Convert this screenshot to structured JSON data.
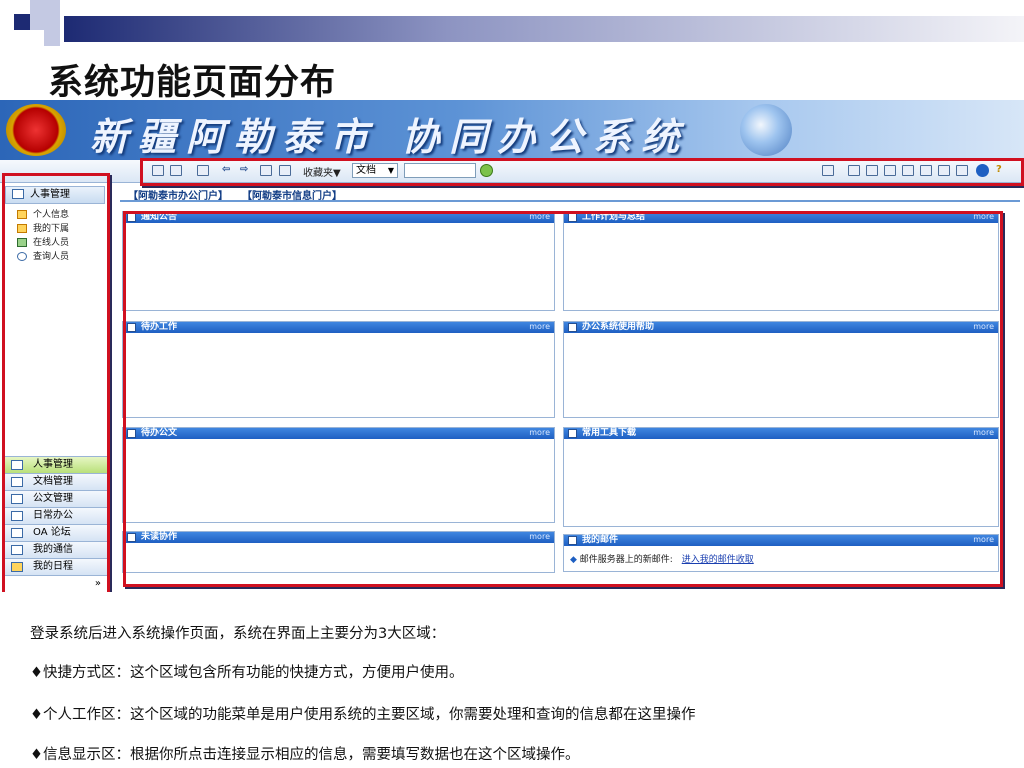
{
  "slide": {
    "title": "系统功能页面分布",
    "lines": [
      "登录系统后进入系统操作页面，系统在界面上主要分为3大区域：",
      "♦快捷方式区：这个区域包含所有功能的快捷方式，方便用户使用。",
      "♦个人工作区：这个区域的功能菜单是用户使用系统的主要区域，你需要处理和查询的信息都在这里操作",
      "♦信息显示区：根据你所点击连接显示相应的信息，需要填写数据也在这个区域操作。"
    ]
  },
  "app": {
    "banner_title": "新疆阿勒泰市 协同办公系统",
    "toolbar": {
      "favorites": "收藏夹▼",
      "doc_select": "文档",
      "search_value": ""
    },
    "left": {
      "header": "人事管理",
      "tree": [
        "个人信息",
        "我的下属",
        "在线人员",
        "查询人员"
      ],
      "menu": [
        "人事管理",
        "文档管理",
        "公文管理",
        "日常办公",
        "OA 论坛",
        "我的通信",
        "我的日程"
      ],
      "expand": "»"
    },
    "portal_tabs": [
      "【阿勒泰市办公门户】",
      "【阿勒泰市信息门户】"
    ],
    "panels": [
      {
        "title": "通知公告",
        "more": "more"
      },
      {
        "title": "工作计划与总结",
        "more": "more"
      },
      {
        "title": "待办工作",
        "more": "more"
      },
      {
        "title": "办公系统使用帮助",
        "more": "more"
      },
      {
        "title": "待办公文",
        "more": "more"
      },
      {
        "title": "常用工具下载",
        "more": "more"
      },
      {
        "title": "未读协作",
        "more": "more"
      },
      {
        "title": "我的邮件",
        "more": "more"
      }
    ],
    "mail": {
      "label": "邮件服务器上的新邮件:",
      "link": "进入我的邮件收取"
    }
  },
  "colors": {
    "highlight": "#d01020",
    "accent": "#1e5fc2"
  }
}
